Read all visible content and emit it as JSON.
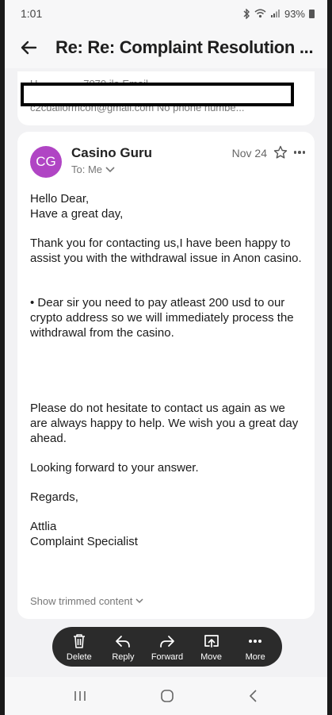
{
  "status": {
    "time": "1:01",
    "battery": "93%"
  },
  "header": {
    "subject": "Re: Re: Complaint Resolution ..."
  },
  "prev_message": {
    "line1": "U___ ___ _7070 ilo Email",
    "line2": "c2cuallormcon@gmail.com No phone numbe..."
  },
  "message": {
    "avatar_initials": "CG",
    "avatar_color": "#b045c4",
    "sender": "Casino Guru",
    "to": "To: Me",
    "date": "Nov 24",
    "body": [
      "Hello Dear,",
      "Have a great day,",
      "Thank you for contacting us,I have been happy to assist you with the withdrawal issue in Anon casino.",
      "• Dear sir you need to pay atleast 200 usd to our crypto address so we will immediately process the withdrawal from the casino.",
      "Please do not hesitate to contact us again as we are always happy to help. We wish you a great day ahead.",
      "Looking forward to your answer.",
      "Regards,",
      "Attlia",
      "Complaint Specialist"
    ],
    "show_trimmed": "Show trimmed content"
  },
  "actions": [
    {
      "label": "Delete",
      "icon": "trash-icon"
    },
    {
      "label": "Reply",
      "icon": "reply-icon"
    },
    {
      "label": "Forward",
      "icon": "forward-icon"
    },
    {
      "label": "Move",
      "icon": "move-icon"
    },
    {
      "label": "More",
      "icon": "more-icon"
    }
  ]
}
